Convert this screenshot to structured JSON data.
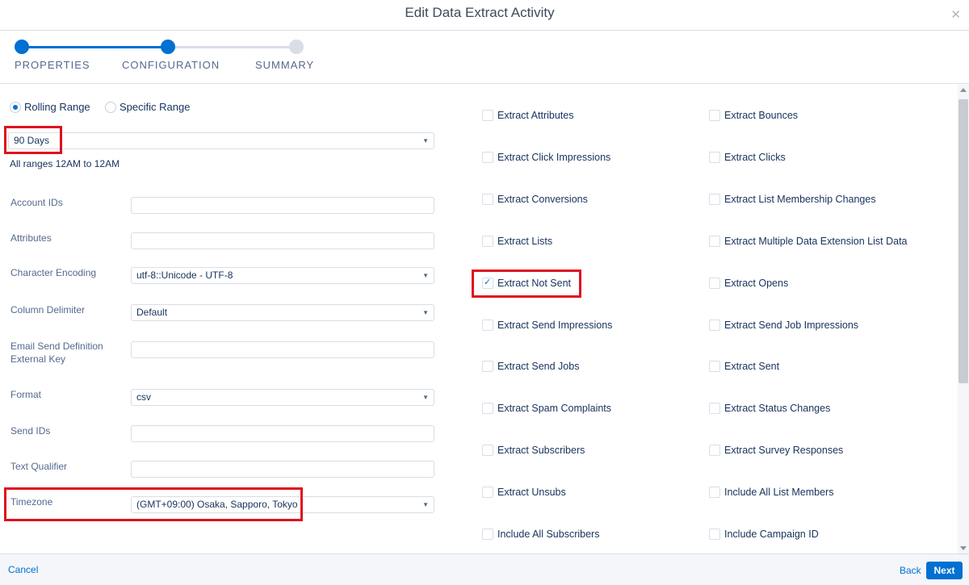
{
  "dialog": {
    "title": "Edit Data Extract Activity"
  },
  "steps": [
    {
      "label": "PROPERTIES",
      "status": "complete"
    },
    {
      "label": "CONFIGURATION",
      "status": "current"
    },
    {
      "label": "SUMMARY",
      "status": "pending"
    }
  ],
  "range": {
    "options": [
      "Rolling Range",
      "Specific Range"
    ],
    "selected": "Rolling Range",
    "period": "90 Days",
    "hint": "All ranges 12AM to 12AM"
  },
  "fields": [
    {
      "label": "Account IDs",
      "type": "text",
      "value": ""
    },
    {
      "label": "Attributes",
      "type": "text",
      "value": ""
    },
    {
      "label": "Character Encoding",
      "type": "select",
      "value": "utf-8::Unicode - UTF-8"
    },
    {
      "label": "Column Delimiter",
      "type": "select",
      "value": "Default"
    },
    {
      "label": "Email Send Definition External Key",
      "type": "text",
      "value": ""
    },
    {
      "label": "Format",
      "type": "select",
      "value": "csv"
    },
    {
      "label": "Send IDs",
      "type": "text",
      "value": ""
    },
    {
      "label": "Text Qualifier",
      "type": "text",
      "value": ""
    },
    {
      "label": "Timezone",
      "type": "select",
      "value": "(GMT+09:00) Osaka, Sapporo, Tokyo"
    }
  ],
  "checkboxes": {
    "left": [
      {
        "label": "Extract Attributes",
        "checked": false
      },
      {
        "label": "Extract Click Impressions",
        "checked": false
      },
      {
        "label": "Extract Conversions",
        "checked": false
      },
      {
        "label": "Extract Lists",
        "checked": false
      },
      {
        "label": "Extract Not Sent",
        "checked": true
      },
      {
        "label": "Extract Send Impressions",
        "checked": false
      },
      {
        "label": "Extract Send Jobs",
        "checked": false
      },
      {
        "label": "Extract Spam Complaints",
        "checked": false
      },
      {
        "label": "Extract Subscribers",
        "checked": false
      },
      {
        "label": "Extract Unsubs",
        "checked": false
      },
      {
        "label": "Include All Subscribers",
        "checked": false
      }
    ],
    "right": [
      {
        "label": "Extract Bounces",
        "checked": false
      },
      {
        "label": "Extract Clicks",
        "checked": false
      },
      {
        "label": "Extract List Membership Changes",
        "checked": false
      },
      {
        "label": "Extract Multiple Data Extension List Data",
        "checked": false
      },
      {
        "label": "Extract Opens",
        "checked": false
      },
      {
        "label": "Extract Send Job Impressions",
        "checked": false
      },
      {
        "label": "Extract Sent",
        "checked": false
      },
      {
        "label": "Extract Status Changes",
        "checked": false
      },
      {
        "label": "Extract Survey Responses",
        "checked": false
      },
      {
        "label": "Include All List Members",
        "checked": false
      },
      {
        "label": "Include Campaign ID",
        "checked": false
      }
    ]
  },
  "footer": {
    "cancel": "Cancel",
    "back": "Back",
    "next": "Next"
  },
  "colors": {
    "accent": "#0070d2",
    "highlight": "#e0101e",
    "border": "#d8dde6",
    "label": "#54698d"
  }
}
